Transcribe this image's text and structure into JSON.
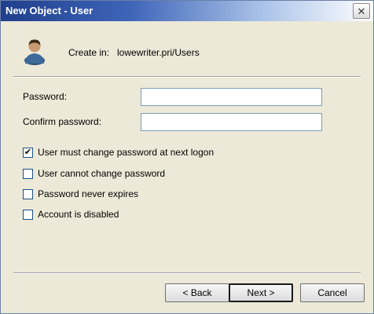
{
  "window": {
    "title": "New Object - User",
    "close_symbol": "✕"
  },
  "header": {
    "icon": "user-icon",
    "create_in_label": "Create in:",
    "create_in_value": "lowewriter.pri/Users"
  },
  "fields": {
    "password_label": "Password:",
    "password_value": "",
    "confirm_label": "Confirm password:",
    "confirm_value": ""
  },
  "checkboxes": [
    {
      "label": "User must change password at next logon",
      "checked": true
    },
    {
      "label": "User cannot change password",
      "checked": false
    },
    {
      "label": "Password never expires",
      "checked": false
    },
    {
      "label": "Account is disabled",
      "checked": false
    }
  ],
  "buttons": {
    "back": "< Back",
    "next": "Next >",
    "cancel": "Cancel"
  }
}
